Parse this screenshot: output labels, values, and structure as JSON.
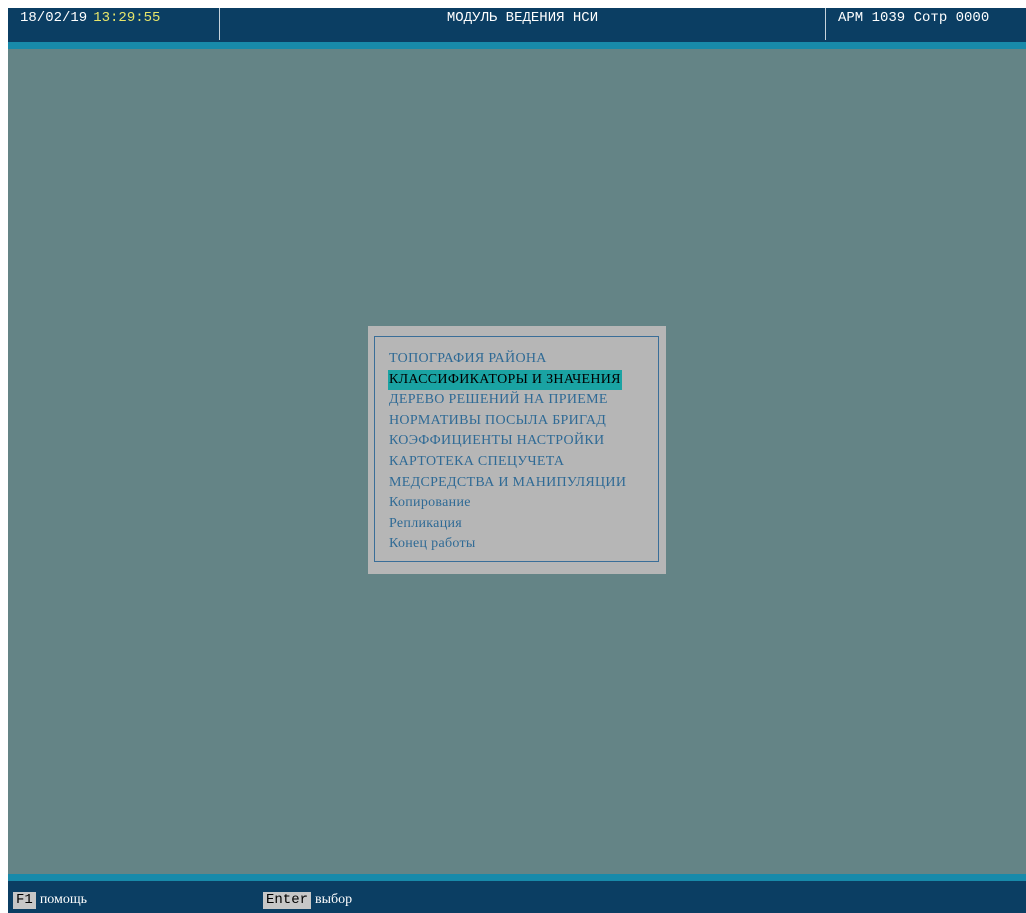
{
  "header": {
    "date": "18/02/19",
    "time": "13:29:55",
    "title": "МОДУЛЬ ВЕДЕНИЯ НСИ",
    "workstation": "АРМ 1039 Сотр 0000"
  },
  "menu": {
    "items": [
      {
        "label": "ТОПОГРАФИЯ РАЙОНА",
        "selected": false
      },
      {
        "label": "КЛАССИФИКАТОРЫ И ЗНАЧЕНИЯ",
        "selected": true
      },
      {
        "label": "ДЕРЕВО РЕШЕНИЙ НА ПРИЕМЕ",
        "selected": false
      },
      {
        "label": "НОРМАТИВЫ ПОСЫЛА БРИГАД",
        "selected": false
      },
      {
        "label": "КОЭФФИЦИЕНТЫ НАСТРОЙКИ",
        "selected": false
      },
      {
        "label": "КАРТОТЕКА СПЕЦУЧЕТА",
        "selected": false
      },
      {
        "label": "МЕДСРЕДСТВА И МАНИПУЛЯЦИИ",
        "selected": false
      },
      {
        "label": "Копирование",
        "selected": false
      },
      {
        "label": "Репликация",
        "selected": false
      },
      {
        "label": "Конец работы",
        "selected": false
      }
    ]
  },
  "footer": {
    "hints": [
      {
        "key": "F1",
        "label": "помощь"
      },
      {
        "key": "Enter",
        "label": "выбор"
      }
    ]
  },
  "colors": {
    "bar_background": "#0b3e63",
    "accent_stripe": "#188aaa",
    "desktop": "#648486",
    "menu_background": "#b6b6b6",
    "menu_text": "#2f6a95",
    "selection": "#1aa3a3",
    "time_text": "#e6e56a"
  }
}
